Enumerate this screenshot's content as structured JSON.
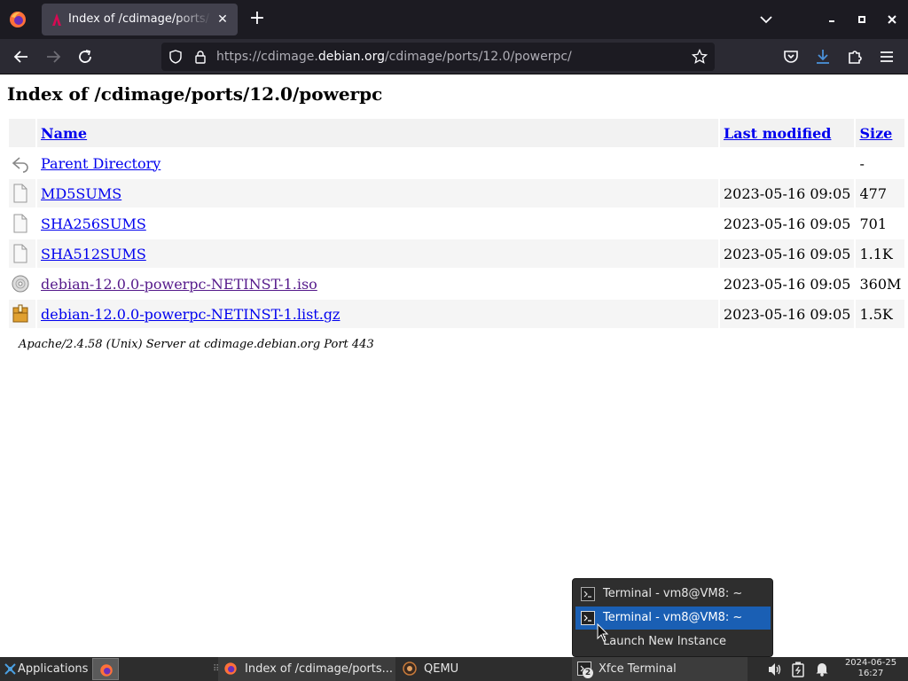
{
  "browser": {
    "tab_title": "Index of /cdimage/ports/12.0/powerpc",
    "close_glyph": "✕",
    "new_tab_glyph": "+",
    "url": {
      "prefix": "https://cdimage.",
      "host": "debian.org",
      "path": "/cdimage/ports/12.0/powerpc/"
    }
  },
  "page": {
    "title": "Index of /cdimage/ports/12.0/powerpc",
    "columns": {
      "name": "Name",
      "last_modified": "Last modified",
      "size": "Size"
    },
    "rows": [
      {
        "icon": "back-icon",
        "name": "Parent Directory",
        "modified": "",
        "size": "-"
      },
      {
        "icon": "text-file-icon",
        "name": "MD5SUMS",
        "modified": "2023-05-16 09:05",
        "size": "477"
      },
      {
        "icon": "text-file-icon",
        "name": "SHA256SUMS",
        "modified": "2023-05-16 09:05",
        "size": "701"
      },
      {
        "icon": "text-file-icon",
        "name": "SHA512SUMS",
        "modified": "2023-05-16 09:05",
        "size": "1.1K"
      },
      {
        "icon": "disc-icon",
        "name": "debian-12.0.0-powerpc-NETINST-1.iso",
        "modified": "2023-05-16 09:05",
        "size": "360M"
      },
      {
        "icon": "archive-icon",
        "name": "debian-12.0.0-powerpc-NETINST-1.list.gz",
        "modified": "2023-05-16 09:05",
        "size": "1.5K"
      }
    ],
    "server_signature": "Apache/2.4.58 (Unix) Server at cdimage.debian.org Port 443"
  },
  "popup_menu": {
    "items": [
      {
        "icon": "terminal-icon",
        "label": "Terminal - vm8@VM8: ~",
        "selected": false
      },
      {
        "icon": "terminal-icon",
        "label": "Terminal - vm8@VM8: ~",
        "selected": true
      },
      {
        "icon": "",
        "label": "Launch New Instance",
        "selected": false
      }
    ]
  },
  "panel": {
    "applications_label": "Applications",
    "separator_glyph": "⠿",
    "tasks": [
      {
        "icon": "firefox-icon",
        "label": "Index of /cdimage/ports..."
      },
      {
        "icon": "qemu-icon",
        "label": "QEMU"
      },
      {
        "icon": "terminal-icon",
        "label": "Xfce Terminal",
        "count": "2"
      }
    ],
    "clock": {
      "date": "2024-06-25",
      "time": "16:27"
    }
  },
  "colors": {
    "link": "#0000ee",
    "visited_link": "#551a8b",
    "selection": "#1a5fb4",
    "browser_toolbar": "#2b2a33",
    "tab_strip": "#1c1b22"
  }
}
